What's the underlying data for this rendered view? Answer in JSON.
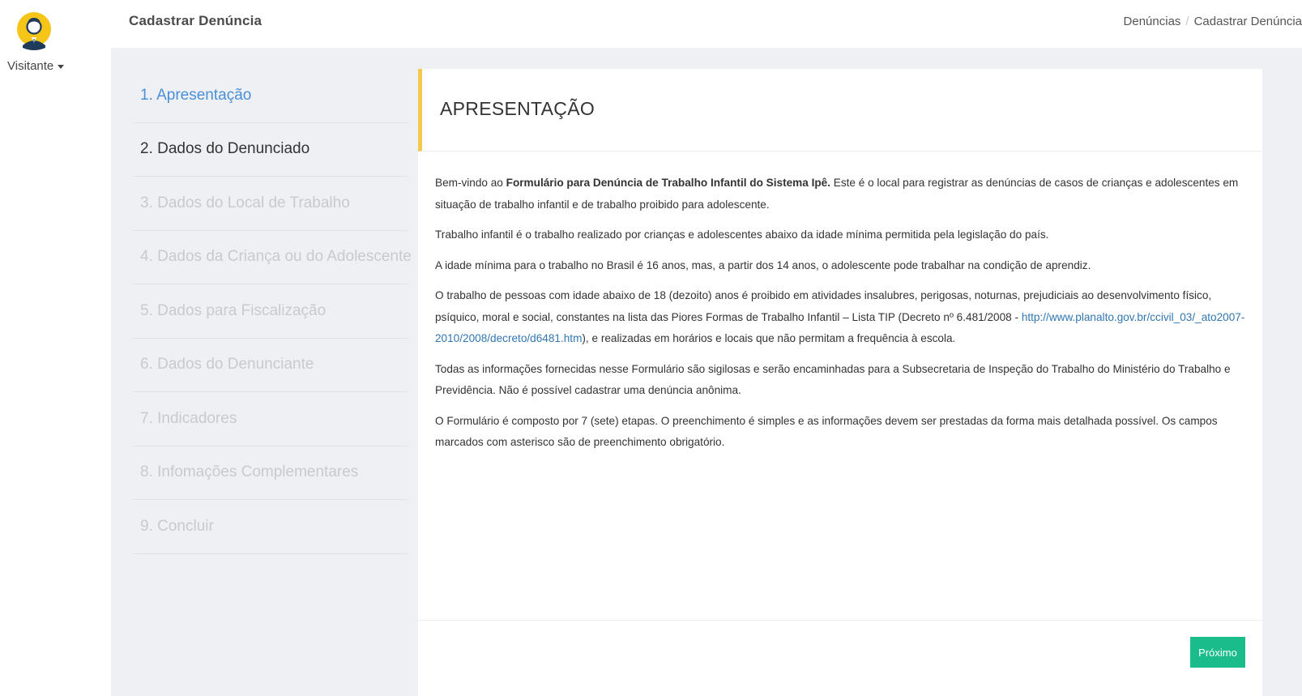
{
  "user": {
    "name": "Visitante"
  },
  "header": {
    "title": "Cadastrar Denúncia",
    "breadcrumb": [
      "Denúncias",
      "Cadastrar Denúncia"
    ],
    "breadcrumb_separator": "/"
  },
  "steps": [
    {
      "label": "1. Apresentação",
      "state": "active"
    },
    {
      "label": "2. Dados do Denunciado",
      "state": "done"
    },
    {
      "label": "3. Dados do Local de Trabalho",
      "state": "disabled"
    },
    {
      "label": "4. Dados da Criança ou do Adolescente",
      "state": "disabled"
    },
    {
      "label": "5. Dados para Fiscalização",
      "state": "disabled"
    },
    {
      "label": "6. Dados do Denunciante",
      "state": "disabled"
    },
    {
      "label": "7. Indicadores",
      "state": "disabled"
    },
    {
      "label": "8. Infomações Complementares",
      "state": "disabled"
    },
    {
      "label": "9. Concluir",
      "state": "disabled"
    }
  ],
  "card": {
    "title": "APRESENTAÇÃO",
    "paragraphs": {
      "p1_prefix": "Bem-vindo ao ",
      "p1_bold": "Formulário para Denúncia de Trabalho Infantil do Sistema Ipê.",
      "p1_suffix": " Este é o local para registrar as denúncias de casos de crianças e adolescentes em situação de trabalho infantil e de trabalho proibido para adolescente.",
      "p2": "Trabalho infantil é o trabalho realizado por crianças e adolescentes abaixo da idade mínima permitida pela legislação do país.",
      "p3": "A idade mínima para o trabalho no Brasil é 16 anos, mas, a partir dos 14 anos, o adolescente pode trabalhar na condição de aprendiz.",
      "p4_prefix": "O trabalho de pessoas com idade abaixo de 18 (dezoito) anos é proibido em atividades insalubres, perigosas, noturnas, prejudiciais ao desenvolvimento físico, psíquico, moral e social, constantes na lista das Piores Formas de Trabalho Infantil – Lista TIP (Decreto nº 6.481/2008 - ",
      "p4_link": "http://www.planalto.gov.br/ccivil_03/_ato2007-2010/2008/decreto/d6481.htm",
      "p4_suffix": "), e realizadas em horários e locais que não permitam a frequência à escola.",
      "p5": "Todas as informações fornecidas nesse Formulário são sigilosas e serão encaminhadas para a Subsecretaria de Inspeção do Trabalho do Ministério do Trabalho e Previdência. Não é possível cadastrar uma denúncia anônima.",
      "p6": "O Formulário é composto por 7 (sete) etapas. O preenchimento é simples e as informações devem ser prestadas da forma mais detalhada possível. Os campos marcados com asterisco são de preenchimento obrigatório."
    },
    "next_button": "Próximo"
  },
  "colors": {
    "accent_yellow": "#f2c94c",
    "active_step": "#4a8fd8",
    "next_button": "#1abc8c",
    "link": "#3276b1",
    "background": "#eef0f4"
  }
}
